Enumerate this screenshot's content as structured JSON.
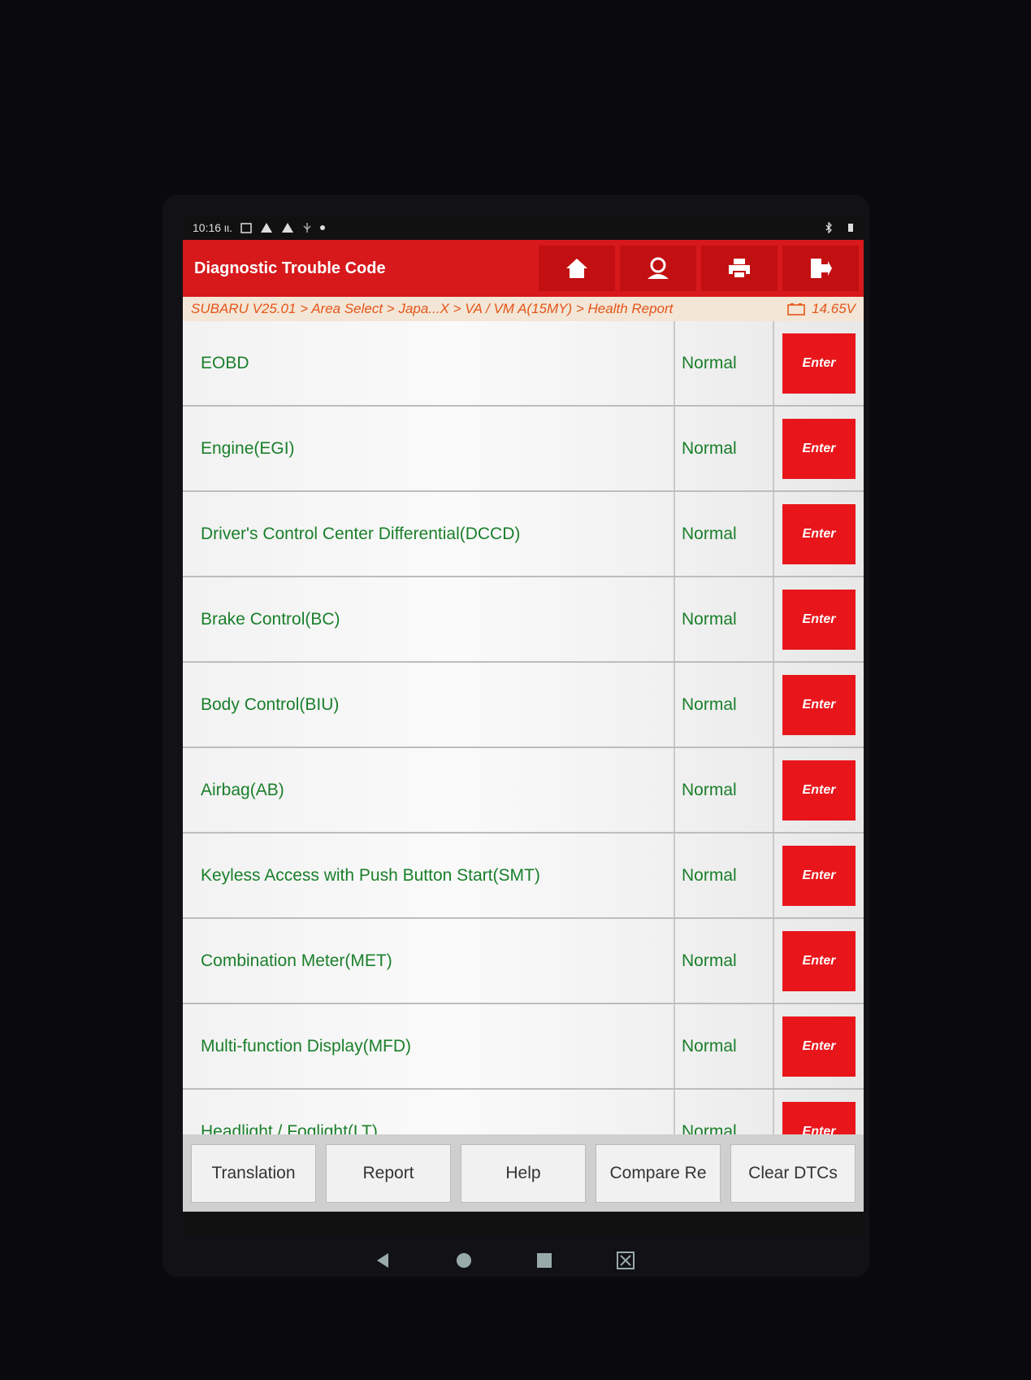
{
  "status_bar": {
    "time": "10:16 ιι.",
    "icons": [
      "calendar-icon",
      "warning-icon",
      "warning-icon",
      "usb-icon",
      "dot-icon"
    ],
    "right_icons": [
      "bluetooth-icon",
      "battery-icon"
    ]
  },
  "header": {
    "title": "Diagnostic Trouble Code",
    "buttons": [
      {
        "name": "home-icon"
      },
      {
        "name": "user-icon"
      },
      {
        "name": "print-icon"
      },
      {
        "name": "exit-icon"
      }
    ]
  },
  "breadcrumb": {
    "path": "SUBARU V25.01 > Area Select > Japa...X > VA / VM A(15MY) > Health Report",
    "voltage": "14.65V"
  },
  "rows": [
    {
      "name": "EOBD",
      "status": "Normal",
      "action": "Enter"
    },
    {
      "name": "Engine(EGI)",
      "status": "Normal",
      "action": "Enter"
    },
    {
      "name": "Driver's Control Center Differential(DCCD)",
      "status": "Normal",
      "action": "Enter"
    },
    {
      "name": "Brake Control(BC)",
      "status": "Normal",
      "action": "Enter"
    },
    {
      "name": "Body Control(BIU)",
      "status": "Normal",
      "action": "Enter"
    },
    {
      "name": "Airbag(AB)",
      "status": "Normal",
      "action": "Enter"
    },
    {
      "name": "Keyless Access with Push Button Start(SMT)",
      "status": "Normal",
      "action": "Enter"
    },
    {
      "name": "Combination Meter(MET)",
      "status": "Normal",
      "action": "Enter"
    },
    {
      "name": "Multi-function Display(MFD)",
      "status": "Normal",
      "action": "Enter"
    },
    {
      "name": "Headlight / Foglight(LT)",
      "status": "Normal",
      "action": "Enter"
    }
  ],
  "bottom_buttons": [
    {
      "label": "Translation"
    },
    {
      "label": "Report"
    },
    {
      "label": "Help"
    },
    {
      "label": "Compare Re"
    },
    {
      "label": "Clear DTCs"
    }
  ],
  "colors": {
    "accent_red": "#d7191c",
    "enter_red": "#e8161b",
    "text_green": "#1a7f2a",
    "breadcrumb_orange": "#e4551a"
  }
}
